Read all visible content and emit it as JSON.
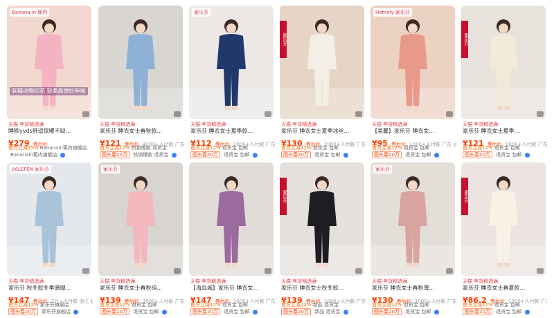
{
  "products": [
    {
      "img_bg": "#f1d9cf",
      "fig_color": "#f4b3c2",
      "l1_tags": "天猫 年货精选满",
      "title": "睡欧yyds舒适保暖不缺...",
      "price": "¥279",
      "price_label": "券后价",
      "meta": "",
      "shipping": "官方立减15%",
      "store_extra": "Bananain蕉内旗舰店",
      "coupon": "",
      "overlay": "软糯动物印花 软柔高弹好伸展",
      "top_tag": "Banana in 蕉内",
      "strip": ""
    },
    {
      "img_bg": "#d9d6d2",
      "fig_color": "#8fb1d6",
      "l1_tags": "天猫 年货精选满",
      "title": "家乐芬 睡衣女士春秋款...",
      "price": "¥121",
      "price_label": "券后价",
      "meta": "4000+人付款 广东 汕头",
      "shipping": "官方立减12%",
      "store_extra": "热销爆款 退货宝",
      "coupon": "图头春20万",
      "overlay": "",
      "top_tag": "",
      "strip": ""
    },
    {
      "img_bg": "#ebe8e6",
      "fig_color": "#20386b",
      "l1_tags": "天猫 年货精选满",
      "title": "家乐芬 睡衣女士夏季款...",
      "price": "¥112",
      "price_label": "券后价",
      "meta": "2000+人付款 广东 汕头",
      "shipping": "官方立减12%",
      "store_extra": "退货宝 包邮",
      "coupon": "图头春20万",
      "overlay": "",
      "top_tag": "家乐芬",
      "strip": ""
    },
    {
      "img_bg": "#e6d4c6",
      "fig_color": "#f3efe6",
      "l1_tags": "天猫 年货精选满",
      "title": "家乐芬 睡衣女士夏季冰丝...",
      "price": "¥130",
      "price_label": "券后价",
      "meta": "2000+人付款 广东 汕头",
      "shipping": "官方立减12%",
      "store_extra": "退货宝 包邮",
      "coupon": "图头春20万",
      "overlay": "",
      "top_tag": "",
      "strip": "家乐芬"
    },
    {
      "img_bg": "#ecd2c3",
      "fig_color": "#e8998a",
      "l1_tags": "天猫 年货精选满",
      "title": "【美馨】家乐芬 睡衣女...",
      "price": "¥95",
      "price_label": "券后价",
      "meta": "1000+人付款 广东 汕头",
      "shipping": "官方立减12%",
      "store_extra": "退货宝 包邮",
      "coupon": "图头春20万",
      "overlay": "",
      "top_tag": "Homely 家乐芬",
      "strip": ""
    },
    {
      "img_bg": "#e8e2dc",
      "fig_color": "#f2e9d8",
      "l1_tags": "天猫 年货精选满",
      "title": "家乐芬 睡衣女士夏季...",
      "price": "¥121",
      "price_label": "券后价",
      "meta": "1000+人付款 广东 汕头",
      "shipping": "官方立减12%",
      "store_extra": "退货宝 包邮",
      "coupon": "图头春20万",
      "overlay": "",
      "top_tag": "",
      "strip": "家乐芬"
    },
    {
      "img_bg": "#e4e8ec",
      "fig_color": "#a9c3d8",
      "l1_tags": "天猫 年货精选满",
      "title": "家乐芬 秋冬款冬季珊瑚...",
      "price": "¥147",
      "price_label": "券后价",
      "meta": "2万+人付款 浙江 杭州",
      "shipping": "官方立减12%",
      "store_extra": "家乐芬旗舰店",
      "coupon": "图头春20万",
      "overlay": "",
      "top_tag": "JIALEFEN 家乐芬",
      "strip": ""
    },
    {
      "img_bg": "#d8d4d0",
      "fig_color": "#f3b8bd",
      "l1_tags": "天猫 年货精选满",
      "title": "家乐芬 睡衣女士春秋纯...",
      "price": "¥139",
      "price_label": "券后价",
      "meta": "1000+人付款 广东 汕头",
      "shipping": "官方立减12%",
      "store_extra": "退货宝 包邮",
      "coupon": "图头春20万",
      "overlay": "",
      "top_tag": "家乐芬",
      "strip": ""
    },
    {
      "img_bg": "#e2dcd8",
      "fig_color": "#9b6a9e",
      "l1_tags": "天猫 年货精选满",
      "title": "【海岛城】家乐芬 睡衣女...",
      "price": "¥147",
      "price_label": "券后价",
      "meta": "1000+人付款 广东 汕头",
      "shipping": "官方立减12%",
      "store_extra": "退货宝 包邮",
      "coupon": "图头春20万",
      "overlay": "",
      "top_tag": "",
      "strip": ""
    },
    {
      "img_bg": "#e5e0dc",
      "fig_color": "#1d1d22",
      "l1_tags": "天猫 年货精选满",
      "title": "家乐芬 睡衣女士秋冬款...",
      "price": "¥139",
      "price_label": "券后价",
      "meta": "1000+人付款 广东 汕头",
      "shipping": "官方立减12%",
      "store_extra": "新品 退货宝",
      "coupon": "图头春20万",
      "overlay": "",
      "top_tag": "",
      "strip": "家乐芬"
    },
    {
      "img_bg": "#e3ded8",
      "fig_color": "#d9a3a0",
      "l1_tags": "天猫 年货精选满",
      "title": "家乐芬 睡衣女士春秋薄...",
      "price": "¥130",
      "price_label": "券后价",
      "meta": "1000+人付款 广东 汕头",
      "shipping": "官方立减12%",
      "store_extra": "退货宝 包邮",
      "coupon": "图头春20万",
      "overlay": "",
      "top_tag": "家乐芬",
      "strip": ""
    },
    {
      "img_bg": "#ebe4e0",
      "fig_color": "#f7f1e6",
      "l1_tags": "天猫 年货精选满",
      "title": "家乐芬 睡衣女士春夏款...",
      "price": "¥86.2",
      "price_label": "券后价",
      "meta": "1000+人付款 广东 汕头",
      "shipping": "官方立减12%",
      "store_extra": "退货宝 包邮",
      "coupon": "图头春20万",
      "overlay": "",
      "top_tag": "",
      "strip": "家乐芬"
    }
  ]
}
